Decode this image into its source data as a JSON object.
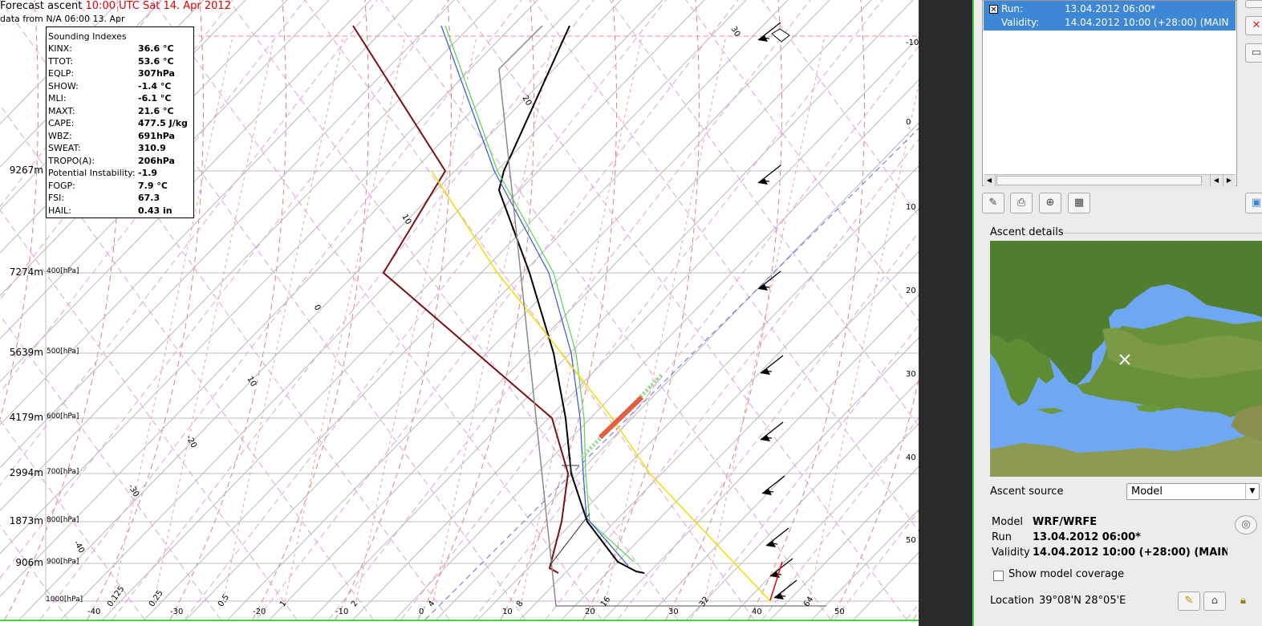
{
  "header": {
    "title_prefix": "Forecast ascent",
    "title_time": "10:00 UTC Sat 14. Apr 2012",
    "data_source": "data from N/A 06:00 13. Apr"
  },
  "indexes": {
    "title": "Sounding Indexes",
    "rows": [
      {
        "k": "KINX:",
        "v": "36.6 °C"
      },
      {
        "k": "TTOT:",
        "v": "53.6 °C"
      },
      {
        "k": "EQLP:",
        "v": "307hPa"
      },
      {
        "k": "SHOW:",
        "v": "-1.4 °C"
      },
      {
        "k": "MLI:",
        "v": "-6.1 °C"
      },
      {
        "k": "MAXT:",
        "v": "21.6 °C"
      },
      {
        "k": "CAPE:",
        "v": "477.5 J/kg"
      },
      {
        "k": "WBZ:",
        "v": "691hPa"
      },
      {
        "k": "SWEAT:",
        "v": "310.9"
      },
      {
        "k": "TROPO(A):",
        "v": "206hPa"
      },
      {
        "k": "Potential Instability:",
        "v": "-1.9"
      },
      {
        "k": "FOGP:",
        "v": "7.9 °C"
      },
      {
        "k": "FSI:",
        "v": "67.3"
      },
      {
        "k": "HAIL:",
        "v": "0.43 in"
      }
    ]
  },
  "levels": [
    {
      "h": "9267m",
      "p": ""
    },
    {
      "h": "7274m",
      "p": "400[hPa]"
    },
    {
      "h": "5639m",
      "p": "500[hPa]"
    },
    {
      "h": "4179m",
      "p": "600[hPa]"
    },
    {
      "h": "2994m",
      "p": "700[hPa]"
    },
    {
      "h": "1873m",
      "p": "800[hPa]"
    },
    {
      "h": "906m",
      "p": "900[hPa]"
    },
    {
      "h": "",
      "p": "1000[hPa]"
    }
  ],
  "temp_ticks": [
    "-40",
    "-30",
    "-20",
    "-10",
    "0",
    "10",
    "20",
    "30",
    "40",
    "50"
  ],
  "mixing_ticks": [
    "0.125",
    "0.25",
    "0.5",
    "1",
    "2",
    "4",
    "8",
    "16",
    "32",
    "64"
  ],
  "right_ticks": [
    "-10",
    "0",
    "10",
    "20",
    "30",
    "40",
    "50"
  ],
  "dry_adiabat_labels": [
    "30",
    "20",
    "10",
    "0",
    "10",
    "-20",
    "-30",
    "-40"
  ],
  "run_list": {
    "run_label": "Run:",
    "run_value": "13.04.2012 06:00*",
    "validity_label": "Validity:",
    "validity_value": "14.04.2012 10:00 (+28:00) (MAIN"
  },
  "ascent_details": {
    "group_title": "Ascent details",
    "source_label": "Ascent source",
    "source_value": "Model",
    "model_label": "Model",
    "model_value": "WRF/WRFE",
    "run_label": "Run",
    "run_value": "13.04.2012 06:00*",
    "validity_label": "Validity",
    "validity_value": "14.04.2012 10:00 (+28:00) (MAIN",
    "coverage_label": "Show model coverage",
    "location_label": "Location",
    "location_value": "39°08'N 28°05'E"
  }
}
